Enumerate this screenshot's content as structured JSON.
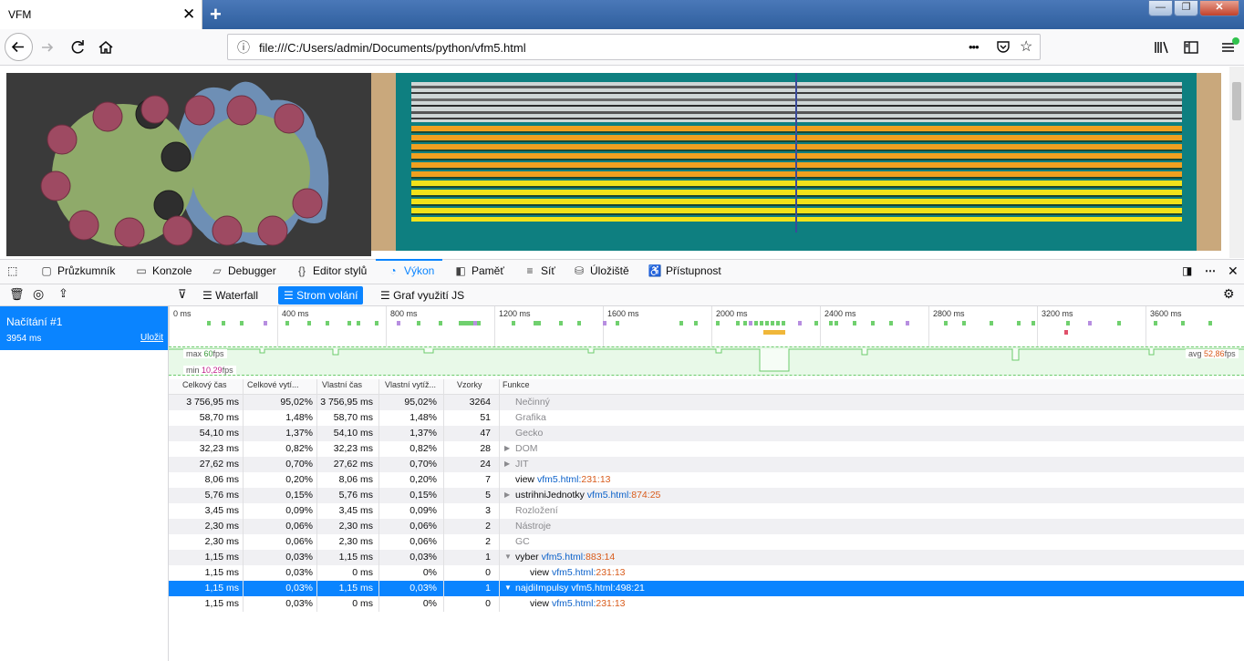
{
  "browser": {
    "tab_title": "VFM",
    "tab_close": "✕",
    "new_tab": "+",
    "window_controls": {
      "minimize": "—",
      "maximize": "❐",
      "close": "✕"
    },
    "url": "file:///C:/Users/admin/Documents/python/vfm5.html",
    "url_more": "•••"
  },
  "devtools": {
    "tabs": [
      {
        "label": "Průzkumník",
        "icon": "inspector-icon"
      },
      {
        "label": "Konzole",
        "icon": "console-icon"
      },
      {
        "label": "Debugger",
        "icon": "debugger-icon"
      },
      {
        "label": "Editor stylů",
        "icon": "style-editor-icon"
      },
      {
        "label": "Výkon",
        "icon": "performance-icon"
      },
      {
        "label": "Paměť",
        "icon": "memory-icon"
      },
      {
        "label": "Síť",
        "icon": "network-icon"
      },
      {
        "label": "Úložiště",
        "icon": "storage-icon"
      },
      {
        "label": "Přístupnost",
        "icon": "accessibility-icon"
      }
    ],
    "active_tab": "Výkon"
  },
  "performance": {
    "recording": {
      "title": "Načítání #1",
      "duration": "3954 ms",
      "save": "Uložit"
    },
    "views": [
      "Waterfall",
      "Strom volání",
      "Graf využití JS"
    ],
    "active_view": "Strom volání",
    "ticks": [
      "0 ms",
      "400 ms",
      "800 ms",
      "1200 ms",
      "1600 ms",
      "2000 ms",
      "2400 ms",
      "2800 ms",
      "3200 ms",
      "3600 ms"
    ],
    "fps": {
      "max_label": "max",
      "max_value": "60",
      "min_label": "min",
      "min_value": "10,29",
      "avg_label": "avg",
      "avg_value": "52,86",
      "unit": "fps"
    },
    "columns": [
      "Celkový čas",
      "Celkové vytí...",
      "Vlastní čas",
      "Vlastní vytíž...",
      "Vzorky",
      "Funkce"
    ],
    "rows": [
      {
        "total": "3 756,95 ms",
        "total_pct": "95,02%",
        "self": "3 756,95 ms",
        "self_pct": "95,02%",
        "samples": "3264",
        "func": "Nečinný",
        "file": "",
        "line": "",
        "col": "",
        "indent": 0,
        "twisty": "",
        "category": true
      },
      {
        "total": "58,70 ms",
        "total_pct": "1,48%",
        "self": "58,70 ms",
        "self_pct": "1,48%",
        "samples": "51",
        "func": "Grafika",
        "file": "",
        "line": "",
        "col": "",
        "indent": 0,
        "twisty": "",
        "category": true
      },
      {
        "total": "54,10 ms",
        "total_pct": "1,37%",
        "self": "54,10 ms",
        "self_pct": "1,37%",
        "samples": "47",
        "func": "Gecko",
        "file": "",
        "line": "",
        "col": "",
        "indent": 0,
        "twisty": "",
        "category": true
      },
      {
        "total": "32,23 ms",
        "total_pct": "0,82%",
        "self": "32,23 ms",
        "self_pct": "0,82%",
        "samples": "28",
        "func": "DOM",
        "file": "",
        "line": "",
        "col": "",
        "indent": 0,
        "twisty": "▶",
        "category": true
      },
      {
        "total": "27,62 ms",
        "total_pct": "0,70%",
        "self": "27,62 ms",
        "self_pct": "0,70%",
        "samples": "24",
        "func": "JIT",
        "file": "",
        "line": "",
        "col": "",
        "indent": 0,
        "twisty": "▶",
        "category": true
      },
      {
        "total": "8,06 ms",
        "total_pct": "0,20%",
        "self": "8,06 ms",
        "self_pct": "0,20%",
        "samples": "7",
        "func": "view",
        "file": "vfm5.html",
        "line": "231",
        "col": "13",
        "indent": 0,
        "twisty": "",
        "category": false
      },
      {
        "total": "5,76 ms",
        "total_pct": "0,15%",
        "self": "5,76 ms",
        "self_pct": "0,15%",
        "samples": "5",
        "func": "ustrihniJednotky",
        "file": "vfm5.html",
        "line": "874",
        "col": "25",
        "indent": 0,
        "twisty": "▶",
        "category": false
      },
      {
        "total": "3,45 ms",
        "total_pct": "0,09%",
        "self": "3,45 ms",
        "self_pct": "0,09%",
        "samples": "3",
        "func": "Rozložení",
        "file": "",
        "line": "",
        "col": "",
        "indent": 0,
        "twisty": "",
        "category": true
      },
      {
        "total": "2,30 ms",
        "total_pct": "0,06%",
        "self": "2,30 ms",
        "self_pct": "0,06%",
        "samples": "2",
        "func": "Nástroje",
        "file": "",
        "line": "",
        "col": "",
        "indent": 0,
        "twisty": "",
        "category": true
      },
      {
        "total": "2,30 ms",
        "total_pct": "0,06%",
        "self": "2,30 ms",
        "self_pct": "0,06%",
        "samples": "2",
        "func": "GC",
        "file": "",
        "line": "",
        "col": "",
        "indent": 0,
        "twisty": "",
        "category": true
      },
      {
        "total": "1,15 ms",
        "total_pct": "0,03%",
        "self": "1,15 ms",
        "self_pct": "0,03%",
        "samples": "1",
        "func": "vyber",
        "file": "vfm5.html",
        "line": "883",
        "col": "14",
        "indent": 0,
        "twisty": "▼",
        "category": false
      },
      {
        "total": "1,15 ms",
        "total_pct": "0,03%",
        "self": "0 ms",
        "self_pct": "0%",
        "samples": "0",
        "func": "view",
        "file": "vfm5.html",
        "line": "231",
        "col": "13",
        "indent": 1,
        "twisty": "",
        "category": false
      },
      {
        "total": "1,15 ms",
        "total_pct": "0,03%",
        "self": "1,15 ms",
        "self_pct": "0,03%",
        "samples": "1",
        "func": "najdiImpulsy",
        "file": "vfm5.html",
        "line": "498",
        "col": "21",
        "indent": 0,
        "twisty": "▼",
        "category": false,
        "selected": true
      },
      {
        "total": "1,15 ms",
        "total_pct": "0,03%",
        "self": "0 ms",
        "self_pct": "0%",
        "samples": "0",
        "func": "view",
        "file": "vfm5.html",
        "line": "231",
        "col": "13",
        "indent": 1,
        "twisty": "",
        "category": false
      }
    ]
  },
  "colors": {
    "accent": "#0a84ff",
    "fps_green": "#6ccb6c",
    "gear_green": "#8faa6a",
    "tooth_pink": "#9e4a62",
    "teal": "#0e7f80",
    "orange": "#f0a020",
    "yellow": "#f2e21a"
  }
}
